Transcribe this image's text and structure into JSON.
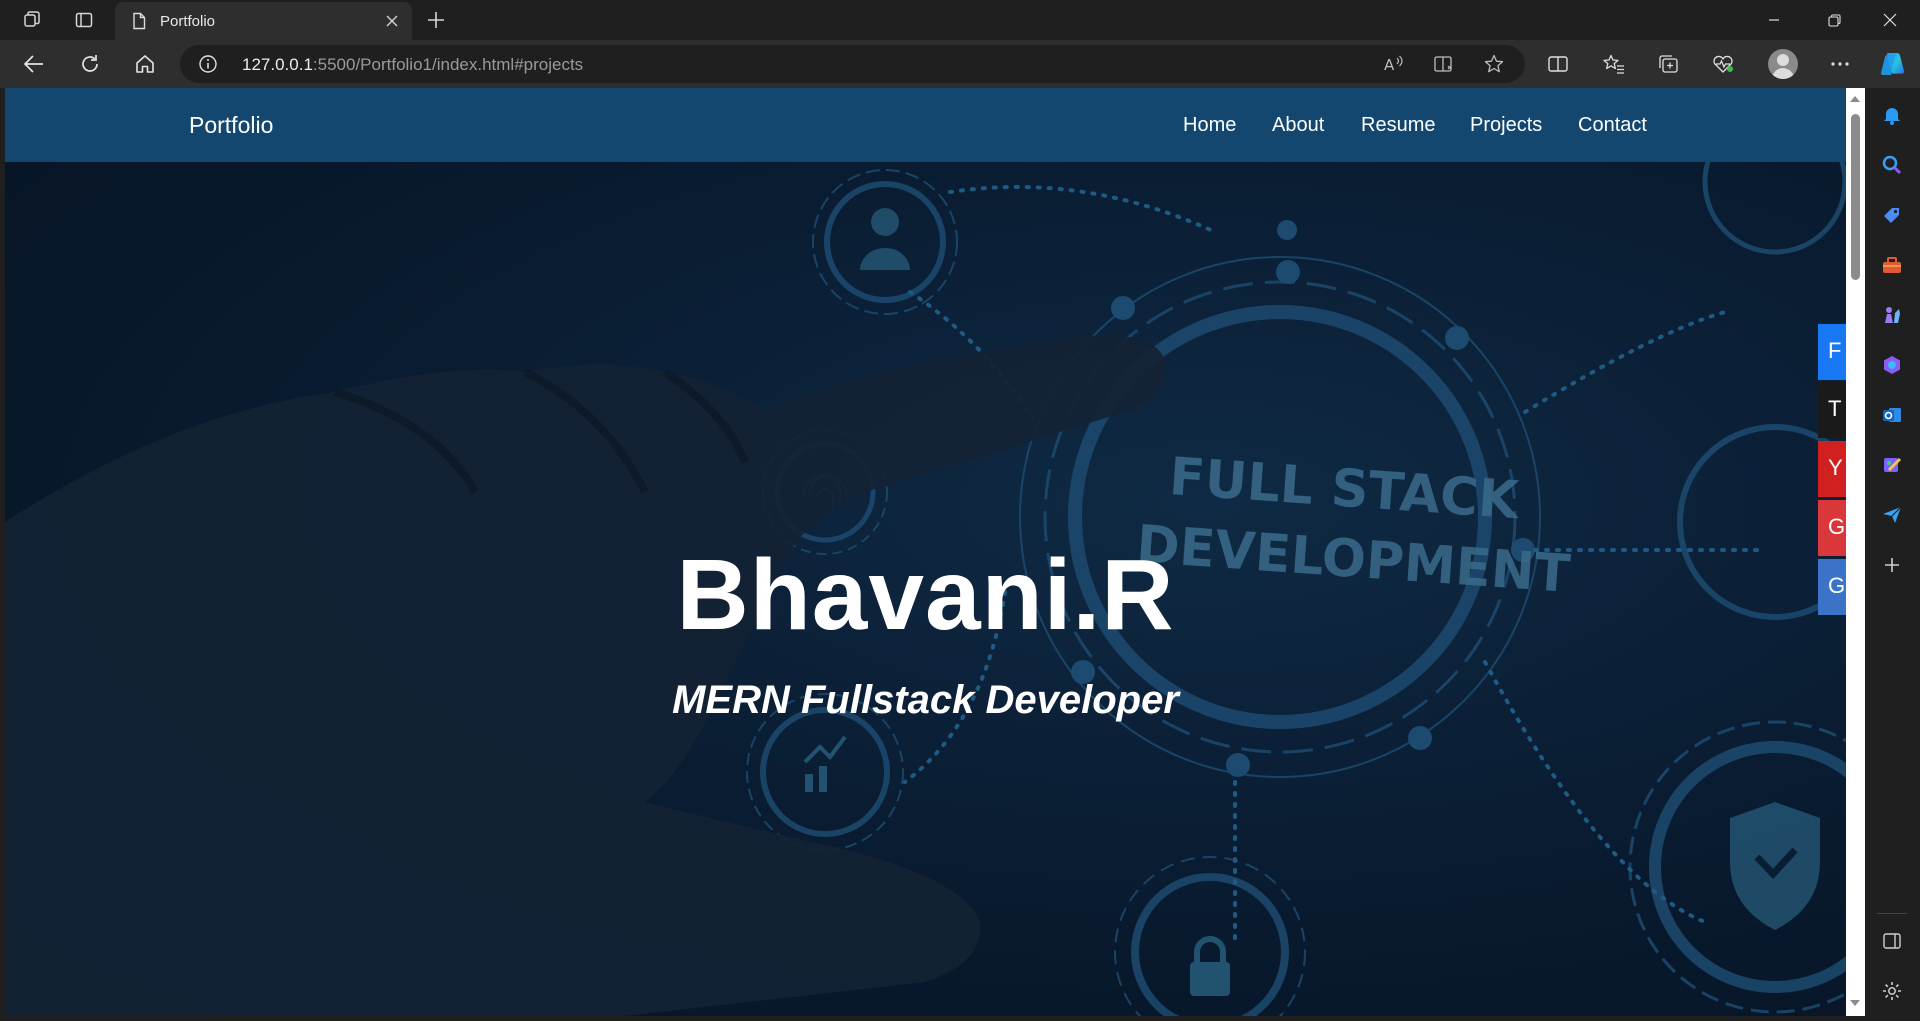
{
  "browser": {
    "tab_title": "Portfolio",
    "url_host": "127.0.0.1",
    "url_rest": ":5500/Portfolio1/index.html#projects"
  },
  "navbar": {
    "brand": "Portfolio",
    "links": [
      "Home",
      "About",
      "Resume",
      "Projects",
      "Contact"
    ]
  },
  "hero": {
    "title": "Bhavani.R",
    "subtitle": "MERN Fullstack Developer",
    "bg_words": [
      "FULL STACK",
      "DEVELOPMENT"
    ]
  },
  "social_tabs": [
    {
      "letter": "F",
      "color": "#1877f2"
    },
    {
      "letter": "T",
      "color": "#1a1a1a"
    },
    {
      "letter": "Y",
      "color": "#d0201f"
    },
    {
      "letter": "G",
      "color": "#d9373a"
    },
    {
      "letter": "G",
      "color": "#3b73c9"
    }
  ],
  "colors": {
    "navbar": "#134770",
    "hero_bg": "#0a1d33",
    "browser_chrome": "#2e2e2e"
  },
  "sidebar_icons": [
    "bell-icon",
    "search-icon",
    "tag-icon",
    "toolbox-icon",
    "chess-icon",
    "copilot-icon",
    "outlook-icon",
    "designer-icon",
    "send-icon",
    "plus-icon",
    "split-pane-icon",
    "settings-icon"
  ]
}
